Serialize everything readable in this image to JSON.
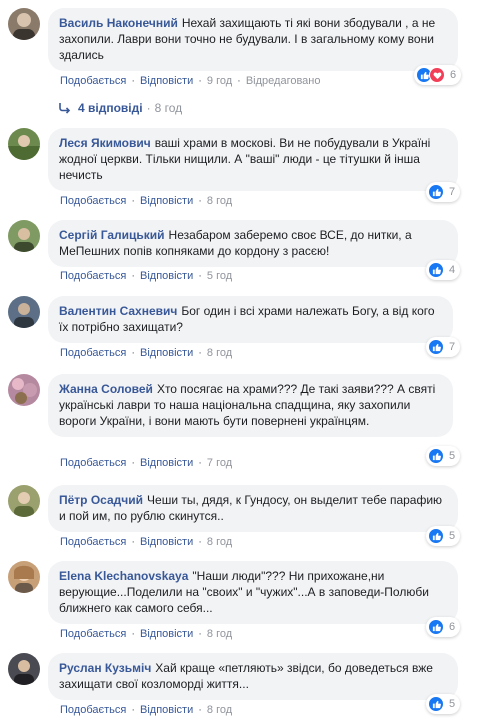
{
  "actions": {
    "like": "Подобається",
    "reply": "Відповісти",
    "sep": "·",
    "edited": "Відредаговано"
  },
  "replies_thread": {
    "label": "4 відповіді",
    "time": "8 год"
  },
  "comments": [
    {
      "author": "Василь Наконечний",
      "text": "Нехай захищають ті які вони збодували , а не захопили. Лаври вони точно не будували. І в загальному кому вони здались",
      "time": "9 год",
      "reactions": [
        "like",
        "love"
      ],
      "count": "6",
      "avatar": "#8a7a6a"
    },
    {
      "author": "Леся Якимович",
      "text": "ваші храми в москові. Ви не побудували в Україні жодної церкви. Тільки нищили. А \"ваші\" люди - це тітушки й інша нечисть",
      "time": "8 год",
      "reactions": [
        "like"
      ],
      "count": "7",
      "avatar": "#6d8a4e"
    },
    {
      "author": "Сергій Галицький",
      "text": "Незабаром заберемо своє ВСЕ, до нитки, а МеПешних попів копняками до кордону з расєю!",
      "time": "5 год",
      "reactions": [
        "like"
      ],
      "count": "4",
      "avatar": "#7f9a62"
    },
    {
      "author": "Валентин Сахневич",
      "text": "Бог один і всі храми належать Богу, а від кого їх потрібно захищати?",
      "time": "8 год",
      "reactions": [
        "like"
      ],
      "count": "7",
      "avatar": "#5c6f86"
    },
    {
      "author": "Жанна Соловей",
      "text": "Хто посягає на храми??? Де такі заяви??? А святі українські лаври то наша національна спадщина, яку захопили вороги України, і вони мають бути повернені українцям.",
      "time": "7 год",
      "reactions": [
        "like"
      ],
      "count": "5",
      "avatar": "#b58aa0"
    },
    {
      "author": "Пётр Осадчий",
      "text": "Чеши ты, дядя, к Гундосу, он выделит тебе парафию и пой им, по рублю скинутся..",
      "time": "8 год",
      "reactions": [
        "like"
      ],
      "count": "5",
      "avatar": "#9aa06e"
    },
    {
      "author": "Elena Klechanovskaya",
      "text": "\"Наши люди\"??? Ни прихожане,ни верующие...Поделили на \"своих\" и \"чужих\"...А в заповеди-Полюби ближнего как самого себя...",
      "time": "8 год",
      "reactions": [
        "like"
      ],
      "count": "6",
      "avatar": "#c8a078"
    },
    {
      "author": "Руслан Кузьміч",
      "text": "Хай краще «петляють» звідси, бо доведеться вже захищати свої козломорді життя...",
      "time": "8 год",
      "reactions": [
        "like"
      ],
      "count": "5",
      "avatar": "#4a4a52"
    }
  ]
}
